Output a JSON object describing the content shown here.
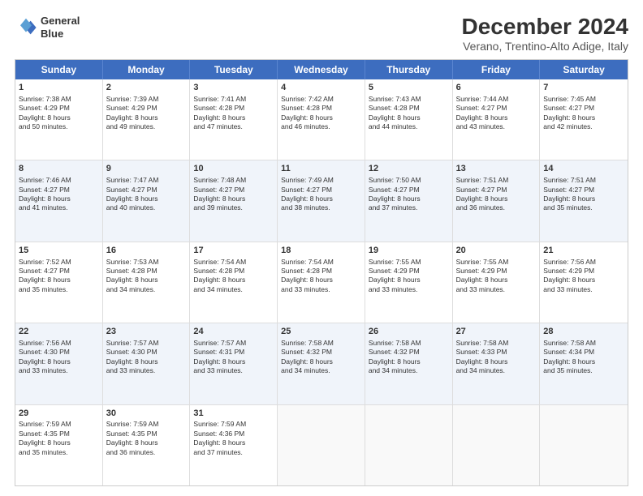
{
  "logo": {
    "line1": "General",
    "line2": "Blue"
  },
  "title": {
    "main": "December 2024",
    "sub": "Verano, Trentino-Alto Adige, Italy"
  },
  "header_days": [
    "Sunday",
    "Monday",
    "Tuesday",
    "Wednesday",
    "Thursday",
    "Friday",
    "Saturday"
  ],
  "rows": [
    {
      "alt": false,
      "cells": [
        {
          "day": "1",
          "lines": [
            "Sunrise: 7:38 AM",
            "Sunset: 4:29 PM",
            "Daylight: 8 hours",
            "and 50 minutes."
          ]
        },
        {
          "day": "2",
          "lines": [
            "Sunrise: 7:39 AM",
            "Sunset: 4:29 PM",
            "Daylight: 8 hours",
            "and 49 minutes."
          ]
        },
        {
          "day": "3",
          "lines": [
            "Sunrise: 7:41 AM",
            "Sunset: 4:28 PM",
            "Daylight: 8 hours",
            "and 47 minutes."
          ]
        },
        {
          "day": "4",
          "lines": [
            "Sunrise: 7:42 AM",
            "Sunset: 4:28 PM",
            "Daylight: 8 hours",
            "and 46 minutes."
          ]
        },
        {
          "day": "5",
          "lines": [
            "Sunrise: 7:43 AM",
            "Sunset: 4:28 PM",
            "Daylight: 8 hours",
            "and 44 minutes."
          ]
        },
        {
          "day": "6",
          "lines": [
            "Sunrise: 7:44 AM",
            "Sunset: 4:27 PM",
            "Daylight: 8 hours",
            "and 43 minutes."
          ]
        },
        {
          "day": "7",
          "lines": [
            "Sunrise: 7:45 AM",
            "Sunset: 4:27 PM",
            "Daylight: 8 hours",
            "and 42 minutes."
          ]
        }
      ]
    },
    {
      "alt": true,
      "cells": [
        {
          "day": "8",
          "lines": [
            "Sunrise: 7:46 AM",
            "Sunset: 4:27 PM",
            "Daylight: 8 hours",
            "and 41 minutes."
          ]
        },
        {
          "day": "9",
          "lines": [
            "Sunrise: 7:47 AM",
            "Sunset: 4:27 PM",
            "Daylight: 8 hours",
            "and 40 minutes."
          ]
        },
        {
          "day": "10",
          "lines": [
            "Sunrise: 7:48 AM",
            "Sunset: 4:27 PM",
            "Daylight: 8 hours",
            "and 39 minutes."
          ]
        },
        {
          "day": "11",
          "lines": [
            "Sunrise: 7:49 AM",
            "Sunset: 4:27 PM",
            "Daylight: 8 hours",
            "and 38 minutes."
          ]
        },
        {
          "day": "12",
          "lines": [
            "Sunrise: 7:50 AM",
            "Sunset: 4:27 PM",
            "Daylight: 8 hours",
            "and 37 minutes."
          ]
        },
        {
          "day": "13",
          "lines": [
            "Sunrise: 7:51 AM",
            "Sunset: 4:27 PM",
            "Daylight: 8 hours",
            "and 36 minutes."
          ]
        },
        {
          "day": "14",
          "lines": [
            "Sunrise: 7:51 AM",
            "Sunset: 4:27 PM",
            "Daylight: 8 hours",
            "and 35 minutes."
          ]
        }
      ]
    },
    {
      "alt": false,
      "cells": [
        {
          "day": "15",
          "lines": [
            "Sunrise: 7:52 AM",
            "Sunset: 4:27 PM",
            "Daylight: 8 hours",
            "and 35 minutes."
          ]
        },
        {
          "day": "16",
          "lines": [
            "Sunrise: 7:53 AM",
            "Sunset: 4:28 PM",
            "Daylight: 8 hours",
            "and 34 minutes."
          ]
        },
        {
          "day": "17",
          "lines": [
            "Sunrise: 7:54 AM",
            "Sunset: 4:28 PM",
            "Daylight: 8 hours",
            "and 34 minutes."
          ]
        },
        {
          "day": "18",
          "lines": [
            "Sunrise: 7:54 AM",
            "Sunset: 4:28 PM",
            "Daylight: 8 hours",
            "and 33 minutes."
          ]
        },
        {
          "day": "19",
          "lines": [
            "Sunrise: 7:55 AM",
            "Sunset: 4:29 PM",
            "Daylight: 8 hours",
            "and 33 minutes."
          ]
        },
        {
          "day": "20",
          "lines": [
            "Sunrise: 7:55 AM",
            "Sunset: 4:29 PM",
            "Daylight: 8 hours",
            "and 33 minutes."
          ]
        },
        {
          "day": "21",
          "lines": [
            "Sunrise: 7:56 AM",
            "Sunset: 4:29 PM",
            "Daylight: 8 hours",
            "and 33 minutes."
          ]
        }
      ]
    },
    {
      "alt": true,
      "cells": [
        {
          "day": "22",
          "lines": [
            "Sunrise: 7:56 AM",
            "Sunset: 4:30 PM",
            "Daylight: 8 hours",
            "and 33 minutes."
          ]
        },
        {
          "day": "23",
          "lines": [
            "Sunrise: 7:57 AM",
            "Sunset: 4:30 PM",
            "Daylight: 8 hours",
            "and 33 minutes."
          ]
        },
        {
          "day": "24",
          "lines": [
            "Sunrise: 7:57 AM",
            "Sunset: 4:31 PM",
            "Daylight: 8 hours",
            "and 33 minutes."
          ]
        },
        {
          "day": "25",
          "lines": [
            "Sunrise: 7:58 AM",
            "Sunset: 4:32 PM",
            "Daylight: 8 hours",
            "and 34 minutes."
          ]
        },
        {
          "day": "26",
          "lines": [
            "Sunrise: 7:58 AM",
            "Sunset: 4:32 PM",
            "Daylight: 8 hours",
            "and 34 minutes."
          ]
        },
        {
          "day": "27",
          "lines": [
            "Sunrise: 7:58 AM",
            "Sunset: 4:33 PM",
            "Daylight: 8 hours",
            "and 34 minutes."
          ]
        },
        {
          "day": "28",
          "lines": [
            "Sunrise: 7:58 AM",
            "Sunset: 4:34 PM",
            "Daylight: 8 hours",
            "and 35 minutes."
          ]
        }
      ]
    },
    {
      "alt": false,
      "cells": [
        {
          "day": "29",
          "lines": [
            "Sunrise: 7:59 AM",
            "Sunset: 4:35 PM",
            "Daylight: 8 hours",
            "and 35 minutes."
          ]
        },
        {
          "day": "30",
          "lines": [
            "Sunrise: 7:59 AM",
            "Sunset: 4:35 PM",
            "Daylight: 8 hours",
            "and 36 minutes."
          ]
        },
        {
          "day": "31",
          "lines": [
            "Sunrise: 7:59 AM",
            "Sunset: 4:36 PM",
            "Daylight: 8 hours",
            "and 37 minutes."
          ]
        },
        {
          "day": "",
          "lines": []
        },
        {
          "day": "",
          "lines": []
        },
        {
          "day": "",
          "lines": []
        },
        {
          "day": "",
          "lines": []
        }
      ]
    }
  ]
}
